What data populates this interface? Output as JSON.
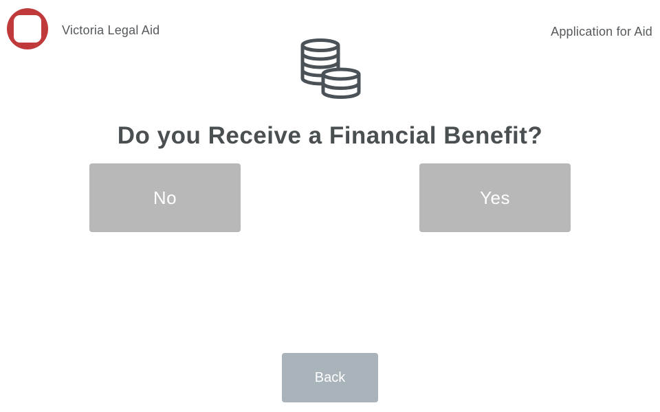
{
  "header": {
    "org_name": "Victoria Legal Aid",
    "page_label": "Application for Aid",
    "logo_color": "#c0393b"
  },
  "main": {
    "icon": "coins-icon",
    "question": "Do you Receive a Financial Benefit?",
    "options": [
      {
        "label": "No"
      },
      {
        "label": "Yes"
      }
    ]
  },
  "footer": {
    "back_label": "Back"
  },
  "colors": {
    "option_button": "#b8b8b8",
    "back_button": "#a9b3ba",
    "text": "#4a4f52"
  }
}
